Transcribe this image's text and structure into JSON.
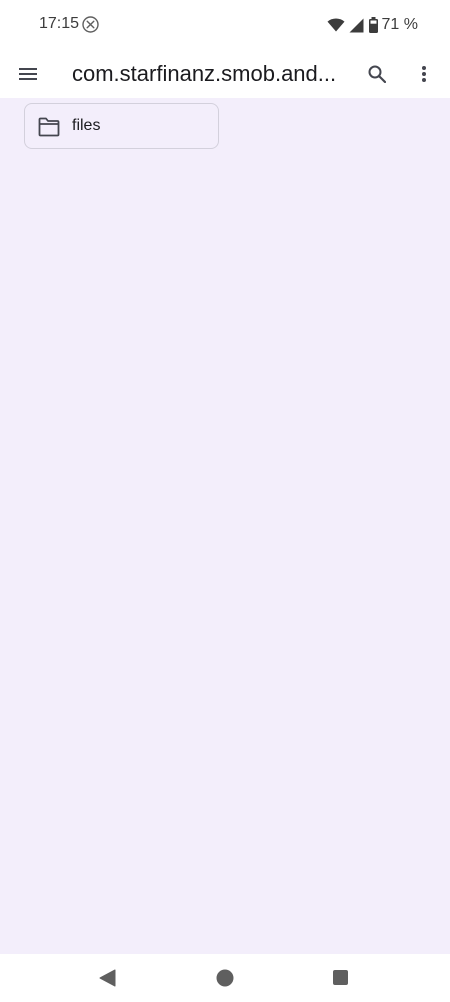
{
  "status_bar": {
    "time": "17:15",
    "battery_percent_text": "71 %",
    "notification_icon": "circle-x-icon",
    "icons": [
      "wifi-icon",
      "cellular-signal-icon",
      "battery-icon"
    ]
  },
  "app_bar": {
    "title": "com.starfinanz.smob.and...",
    "menu_icon": "hamburger-menu-icon",
    "search_icon": "search-icon",
    "more_icon": "more-vert-icon"
  },
  "folders": [
    {
      "name": "files",
      "icon": "folder-icon"
    }
  ],
  "nav_bar": {
    "buttons": [
      "back-icon",
      "home-icon",
      "recents-icon"
    ]
  },
  "colors": {
    "content_background": "#f3eefb",
    "bar_background": "#ffffff",
    "text_primary": "#1b1b1f",
    "icon_color": "#44464f",
    "chip_border": "#d3d0dc"
  }
}
